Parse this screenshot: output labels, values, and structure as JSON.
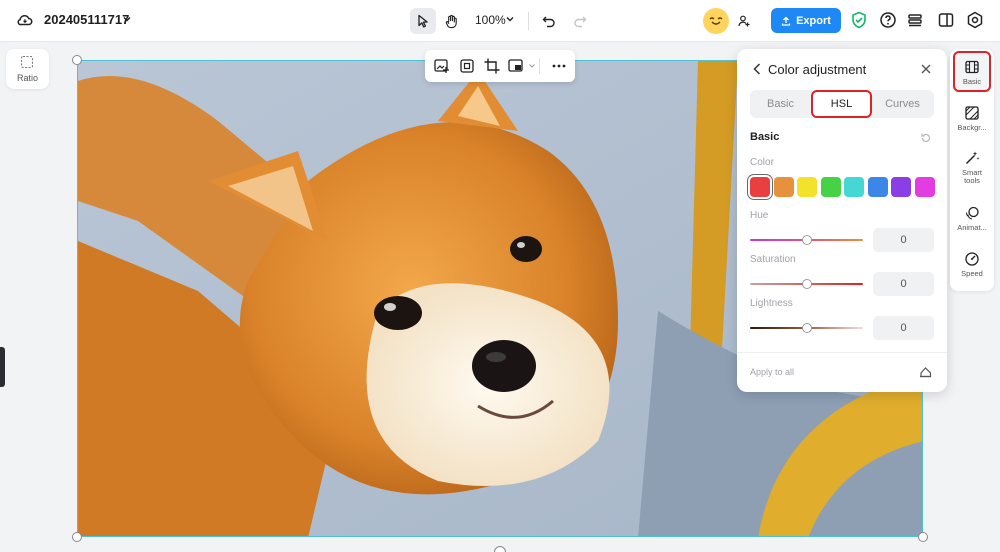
{
  "header": {
    "project_name": "202405111717",
    "zoom": "100%",
    "export_label": "Export"
  },
  "ratio": {
    "label": "Ratio"
  },
  "panel": {
    "title": "Color adjustment",
    "tabs": [
      {
        "label": "Basic",
        "active": false
      },
      {
        "label": "HSL",
        "active": true
      },
      {
        "label": "Curves",
        "active": false
      }
    ],
    "section": "Basic",
    "color_label": "Color",
    "colors": [
      "#e84040",
      "#e8913c",
      "#f2e22c",
      "#46d247",
      "#45d7d3",
      "#3b86e6",
      "#8b3ee6",
      "#e33ce0"
    ],
    "selected_color": 0,
    "sliders": [
      {
        "label": "Hue",
        "value": "0",
        "level": 0.5
      },
      {
        "label": "Saturation",
        "value": "0",
        "level": 0.5
      },
      {
        "label": "Lightness",
        "value": "0",
        "level": 0.5
      }
    ],
    "apply_all": "Apply to all"
  },
  "sidebar": {
    "items": [
      {
        "label": "Basic",
        "icon": "film-icon",
        "active": true
      },
      {
        "label": "Backgr...",
        "icon": "background-icon",
        "active": false
      },
      {
        "label": "Smart tools",
        "icon": "magic-wand-icon",
        "active": false
      },
      {
        "label": "Animat...",
        "icon": "animation-icon",
        "active": false
      },
      {
        "label": "Speed",
        "icon": "speed-icon",
        "active": false
      }
    ]
  },
  "colors": {
    "accent": "#1e88f5",
    "highlight": "#e0212a",
    "selection": "#4fc3d6"
  }
}
